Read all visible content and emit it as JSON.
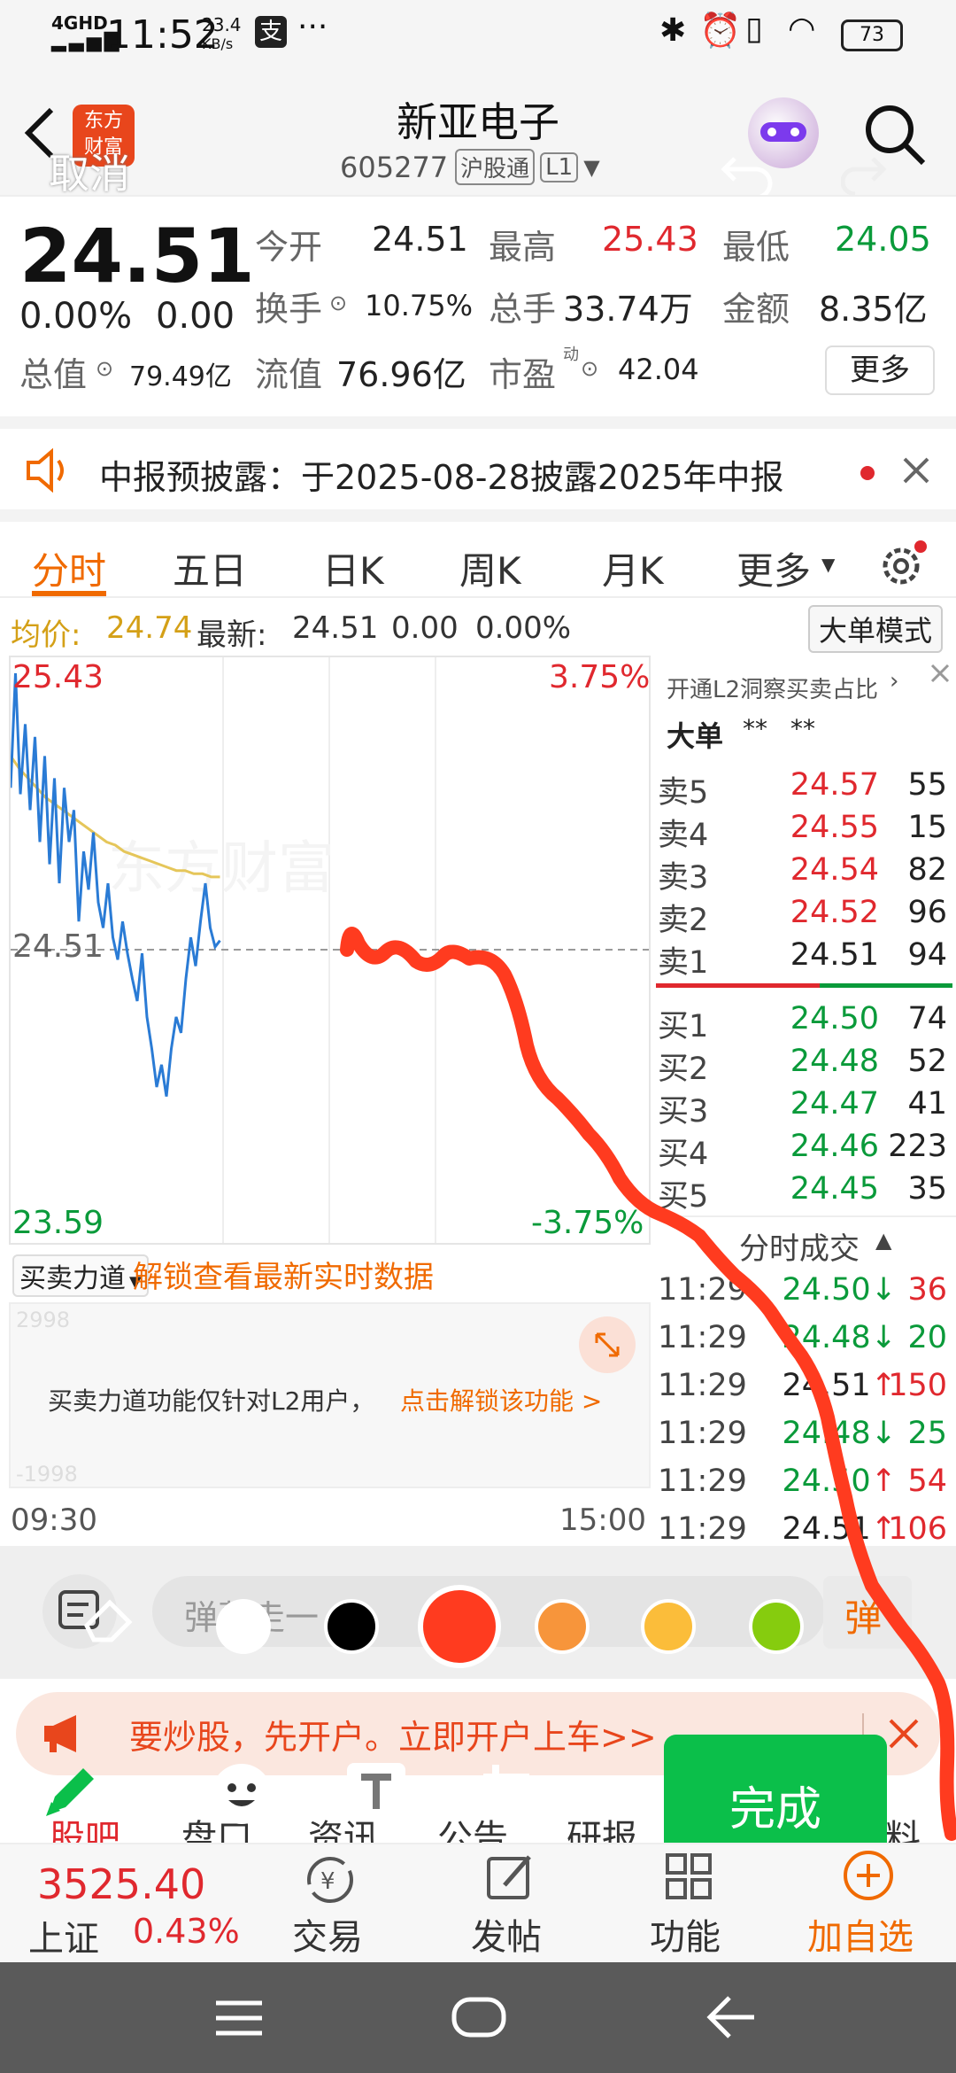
{
  "status_bar": {
    "network": "4GHD",
    "time": "11:52",
    "speed": "23.4",
    "speed_unit": "KB/s",
    "alipay_icon": "支",
    "more": "···",
    "battery": "73"
  },
  "header": {
    "title": "新亚电子",
    "code": "605277",
    "market_tag": "沪股通",
    "level_tag": "L1",
    "logo_text_1": "东方",
    "logo_text_2": "财富",
    "cancel": "取消"
  },
  "quote": {
    "price": "24.51",
    "change_pct": "0.00%",
    "change": "0.00",
    "open_label": "今开",
    "open": "24.51",
    "high_label": "最高",
    "high": "25.43",
    "low_label": "最低",
    "low": "24.05",
    "turnover_label": "换手",
    "turnover": "10.75%",
    "volume_label": "总手",
    "volume": "33.74万",
    "amount_label": "金额",
    "amount": "8.35亿",
    "mcap_label": "总值",
    "mcap": "79.49亿",
    "float_label": "流值",
    "float_mcap": "76.96亿",
    "pe_label": "市盈",
    "pe_sup": "动",
    "pe": "42.04",
    "more_button": "更多"
  },
  "notice": {
    "text": "中报预披露：于2025-08-28披露2025年中报"
  },
  "tabs": [
    "分时",
    "五日",
    "日K",
    "周K",
    "月K",
    "更多"
  ],
  "avg_line": {
    "avg_label": "均价:",
    "avg": "24.74",
    "latest_label": "最新:",
    "latest": "24.51",
    "chg": "0.00",
    "pct": "0.00%",
    "big_order_mode": "大单模式"
  },
  "chart_data": {
    "type": "line",
    "title": "",
    "y_top_label": "25.43",
    "y_mid_label": "24.51",
    "y_bottom_label": "23.59",
    "pct_top": "3.75%",
    "pct_bottom": "-3.75%",
    "ylim": [
      23.59,
      25.43
    ],
    "x_start": "09:30",
    "x_end": "15:00",
    "series": [
      {
        "values": [
          25.02,
          25.38,
          25.0,
          25.22,
          24.95,
          25.18,
          24.85,
          25.12,
          24.78,
          25.05,
          24.72,
          25.02,
          24.85,
          24.95,
          24.6,
          24.82,
          24.7,
          24.88,
          24.66,
          24.58,
          24.72,
          24.55,
          24.48,
          24.6,
          24.5,
          24.42,
          24.35,
          24.5,
          24.3,
          24.2,
          24.08,
          24.15,
          24.05,
          24.2,
          24.3,
          24.25,
          24.42,
          24.55,
          24.46,
          24.6,
          24.72,
          24.58,
          24.52,
          24.54
        ]
      },
      {
        "values": [
          25.12,
          25.08,
          25.05,
          25.02,
          24.99,
          24.97,
          24.95,
          24.93,
          24.91,
          24.89,
          24.87,
          24.85,
          24.84,
          24.82,
          24.81,
          24.8,
          24.79,
          24.78,
          24.77,
          24.76,
          24.76,
          24.75,
          24.75,
          24.74,
          24.74
        ]
      }
    ]
  },
  "order_book": {
    "l2_link": "开通L2洞察买卖占比",
    "big_order_label": "大单",
    "big_order_v1": "**",
    "big_order_v2": "**",
    "asks": [
      {
        "label": "卖5",
        "price": "24.57",
        "qty": "55"
      },
      {
        "label": "卖4",
        "price": "24.55",
        "qty": "15"
      },
      {
        "label": "卖3",
        "price": "24.54",
        "qty": "82"
      },
      {
        "label": "卖2",
        "price": "24.52",
        "qty": "96"
      },
      {
        "label": "卖1",
        "price": "24.51",
        "qty": "94"
      }
    ],
    "bids": [
      {
        "label": "买1",
        "price": "24.50",
        "qty": "74"
      },
      {
        "label": "买2",
        "price": "24.48",
        "qty": "52"
      },
      {
        "label": "买3",
        "price": "24.47",
        "qty": "41"
      },
      {
        "label": "买4",
        "price": "24.46",
        "qty": "223"
      },
      {
        "label": "买5",
        "price": "24.45",
        "qty": "35"
      }
    ],
    "ticks_title": "分时成交",
    "ticks": [
      {
        "time": "11:29",
        "price": "24.50",
        "arrow": "↓",
        "qty": "36"
      },
      {
        "time": "11:29",
        "price": "24.48",
        "arrow": "↓",
        "qty": "20"
      },
      {
        "time": "11:29",
        "price": "24.51",
        "arrow": "↑",
        "qty": "150"
      },
      {
        "time": "11:29",
        "price": "24.48",
        "arrow": "↓",
        "qty": "25"
      },
      {
        "time": "11:29",
        "price": "24.50",
        "arrow": "↑",
        "qty": "54"
      },
      {
        "time": "11:29",
        "price": "24.51",
        "arrow": "↑",
        "qty": "106"
      }
    ]
  },
  "flow_panel": {
    "selector": "买卖力道",
    "unlock_link": "解锁查看最新实时数据",
    "top_value": "2998",
    "bottom_value": "-1998",
    "message": "买卖力道功能仅针对L2用户，",
    "message_link": "点击解锁该功能 >"
  },
  "time_axis": {
    "start": "09:30",
    "end": "15:00"
  },
  "draw_toolbar": {
    "comment_placeholder": "弹幕走一",
    "colors": [
      "#ffffff",
      "#000000",
      "#ff3b1f",
      "#f7953b",
      "#fbbd3a",
      "#86cc0e"
    ],
    "done_button": "完成"
  },
  "promo": {
    "text": "要炒股，先开户。立即开户上车>>"
  },
  "bottom_tabs": [
    "股吧",
    "盘口",
    "资讯",
    "公告",
    "研报",
    "资料"
  ],
  "footer": {
    "index_value": "3525.40",
    "index_name": "上证",
    "index_pct": "0.43%",
    "trade": "交易",
    "post": "发帖",
    "function": "功能",
    "add_watch": "加自选"
  }
}
